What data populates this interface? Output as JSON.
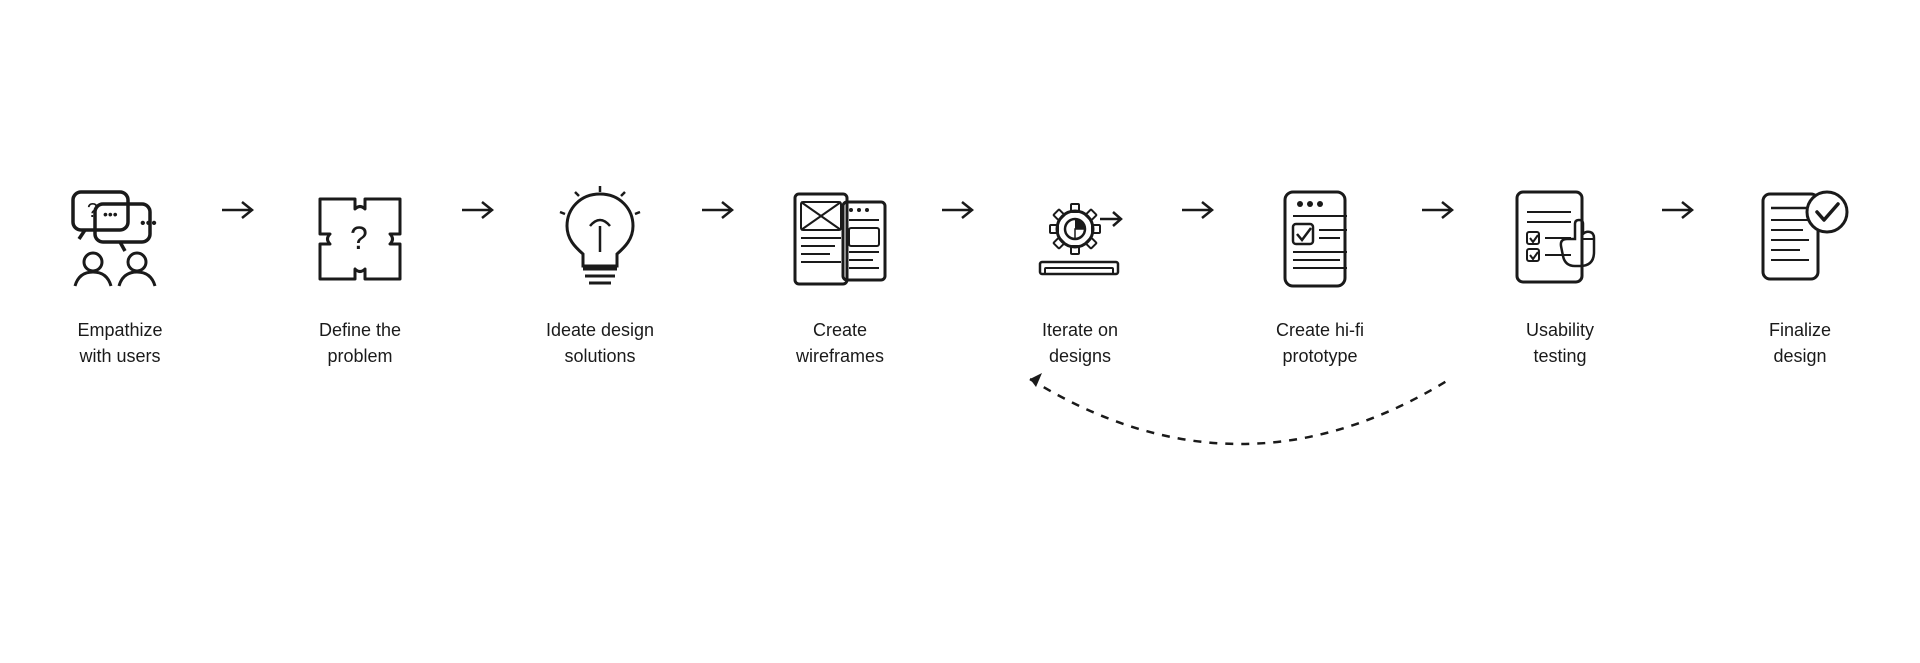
{
  "steps": [
    {
      "id": "empathize",
      "label": "Empathize\nwith users",
      "label_lines": [
        "Empathize",
        "with users"
      ]
    },
    {
      "id": "define",
      "label": "Define the\nproblem",
      "label_lines": [
        "Define the",
        "problem"
      ]
    },
    {
      "id": "ideate",
      "label": "Ideate design\nsolutions",
      "label_lines": [
        "Ideate design",
        "solutions"
      ]
    },
    {
      "id": "wireframes",
      "label": "Create\nwireframes",
      "label_lines": [
        "Create",
        "wireframes"
      ]
    },
    {
      "id": "iterate",
      "label": "Iterate on\ndesigns",
      "label_lines": [
        "Iterate on",
        "designs"
      ]
    },
    {
      "id": "hifi",
      "label": "Create hi-fi\nprototype",
      "label_lines": [
        "Create hi-fi",
        "prototype"
      ]
    },
    {
      "id": "usability",
      "label": "Usability\ntesting",
      "label_lines": [
        "Usability",
        "testing"
      ]
    },
    {
      "id": "finalize",
      "label": "Finalize\ndesign",
      "label_lines": [
        "Finalize",
        "design"
      ]
    }
  ],
  "arrows": {
    "forward_count": 7
  }
}
